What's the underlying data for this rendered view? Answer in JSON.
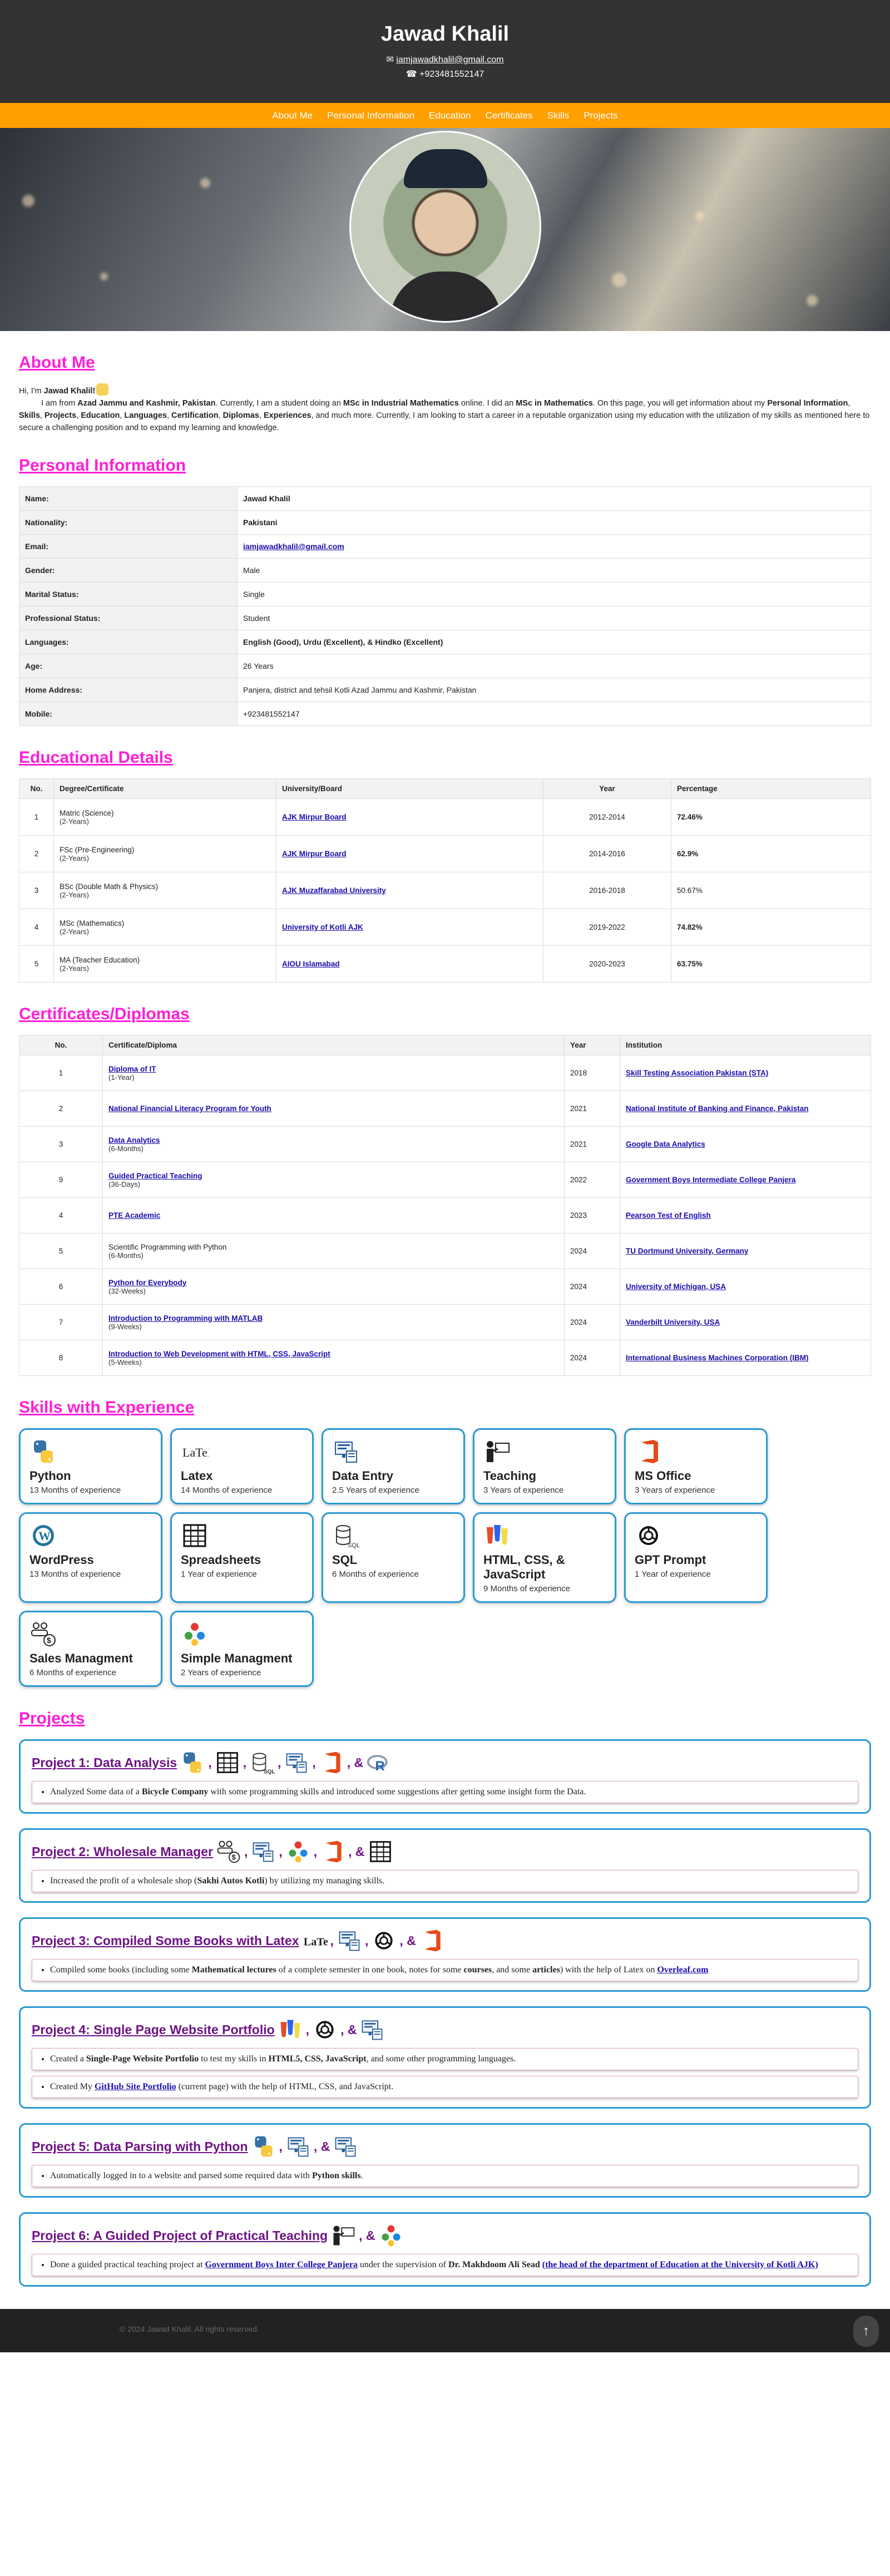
{
  "header": {
    "name": "Jawad Khalil",
    "email": "iamjawadkhalil@gmail.com",
    "phone": "+923481552147"
  },
  "nav": [
    "About Me",
    "Personal Information",
    "Education",
    "Certificates",
    "Skills",
    "Projects"
  ],
  "about": {
    "title": "About Me",
    "greet": "Hi, I'm",
    "name": "Jawad Khalil!",
    "p": [
      {
        "t": "I am from "
      },
      {
        "b": "Azad Jammu and Kashmir, Pakistan"
      },
      {
        "t": ". Currently, I am a student doing an "
      },
      {
        "b": "MSc in Industrial Mathematics"
      },
      {
        "t": " online. I did an "
      },
      {
        "b": "MSc in Mathematics"
      },
      {
        "t": ". On this page, you will get information about my "
      },
      {
        "b": "Personal Information"
      },
      {
        "t": ", "
      },
      {
        "b": "Skills"
      },
      {
        "t": ", "
      },
      {
        "b": "Projects"
      },
      {
        "t": ", "
      },
      {
        "b": "Education"
      },
      {
        "t": ", "
      },
      {
        "b": "Languages"
      },
      {
        "t": ", "
      },
      {
        "b": "Certification"
      },
      {
        "t": ", "
      },
      {
        "b": "Diplomas"
      },
      {
        "t": ", "
      },
      {
        "b": "Experiences"
      },
      {
        "t": ", and much more. Currently, I am looking to start a career in a reputable organization using my education with the utilization of my skills as mentioned here to secure a challenging position and to expand my learning and knowledge."
      }
    ]
  },
  "personal": {
    "title": "Personal Information",
    "rows": [
      {
        "k": "Name:",
        "v": "Jawad Khalil",
        "bold": true
      },
      {
        "k": "Nationality:",
        "v": "Pakistani",
        "bold": true
      },
      {
        "k": "Email:",
        "v": "iamjawadkhalil@gmail.com",
        "link": true
      },
      {
        "k": "Gender:",
        "v": "Male"
      },
      {
        "k": "Marital Status:",
        "v": "Single"
      },
      {
        "k": "Professional Status:",
        "v": "Student"
      },
      {
        "k": "Languages:",
        "v": "English (Good), Urdu (Excellent), & Hindko (Excellent)",
        "bold": true
      },
      {
        "k": "Age:",
        "v": "26 Years"
      },
      {
        "k": "Home Address:",
        "v": "Panjera, district and tehsil Kotli Azad Jammu and Kashmir, Pakistan"
      },
      {
        "k": "Mobile:",
        "v": "+923481552147"
      }
    ]
  },
  "education": {
    "title": "Educational Details",
    "cols": [
      "No.",
      "Degree/Certificate",
      "University/Board",
      "Year",
      "Percentage"
    ],
    "rows": [
      {
        "no": "1",
        "deg": "Matric (Science)",
        "dur": "(2-Years)",
        "uni": "AJK Mirpur Board",
        "year": "2012-2014",
        "pct": "72.46%",
        "pb": true
      },
      {
        "no": "2",
        "deg": "FSc (Pre-Engineering)",
        "dur": "(2-Years)",
        "uni": "AJK Mirpur Board",
        "year": "2014-2016",
        "pct": "62.9%",
        "pb": true
      },
      {
        "no": "3",
        "deg": "BSc (Double Math & Physics)",
        "dur": "(2-Years)",
        "uni": "AJK Muzaffarabad University",
        "year": "2016-2018",
        "pct": "50.67%",
        "pb": false
      },
      {
        "no": "4",
        "deg": "MSc (Mathematics)",
        "dur": "(2-Years)",
        "uni": "University of Kotli AJK",
        "year": "2019-2022",
        "pct": "74.82%",
        "pb": true
      },
      {
        "no": "5",
        "deg": "MA (Teacher Education)",
        "dur": "(2-Years)",
        "uni": "AIOU Islamabad",
        "year": "2020-2023",
        "pct": "63.75%",
        "pb": true
      }
    ]
  },
  "certs": {
    "title": "Certificates/Diplomas",
    "cols": [
      "No.",
      "Certificate/Diploma",
      "Year",
      "Institution"
    ],
    "rows": [
      {
        "no": "1",
        "name": "Diploma of IT",
        "dur": "(1-Year)",
        "link": true,
        "year": "2018",
        "inst": "Skill Testing Association Pakistan (STA)"
      },
      {
        "no": "2",
        "name": "National Financial Literacy Program for Youth",
        "dur": "",
        "link": true,
        "year": "2021",
        "inst": "National Institute of Banking and Finance, Pakistan"
      },
      {
        "no": "3",
        "name": "Data Analytics",
        "dur": "(6-Months)",
        "link": true,
        "year": "2021",
        "inst": "Google Data Analytics"
      },
      {
        "no": "9",
        "name": "Guided Practical Teaching",
        "dur": "(36-Days)",
        "link": true,
        "year": "2022",
        "inst": "Government Boys Intermediate College Panjera"
      },
      {
        "no": "4",
        "name": "PTE Academic",
        "dur": "",
        "link": true,
        "year": "2023",
        "inst": "Pearson Test of English"
      },
      {
        "no": "5",
        "name": "Scientific Programming with Python",
        "dur": "(6-Months)",
        "link": false,
        "year": "2024",
        "inst": "TU Dortmund University, Germany"
      },
      {
        "no": "6",
        "name": "Python for Everybody",
        "dur": "(32-Weeks)",
        "link": true,
        "year": "2024",
        "inst": "University of Michigan, USA"
      },
      {
        "no": "7",
        "name": "Introduction to Programming with MATLAB",
        "dur": "(9-Weeks)",
        "link": true,
        "year": "2024",
        "inst": "Vanderbilt University, USA"
      },
      {
        "no": "8",
        "name": "Introduction to Web Development with HTML, CSS, JavaScript",
        "dur": "(5-Weeks)",
        "link": true,
        "year": "2024",
        "inst": "International Business Machines Corporation (IBM)"
      }
    ]
  },
  "skills": {
    "title": "Skills with Experience",
    "items": [
      {
        "icon": "python-icon",
        "name": "Python",
        "exp": "13 Months of experience"
      },
      {
        "icon": "latex-icon",
        "name": "Latex",
        "exp": "14 Months of experience"
      },
      {
        "icon": "data-entry-icon",
        "name": "Data Entry",
        "exp": "2.5 Years of experience"
      },
      {
        "icon": "teaching-icon",
        "name": "Teaching",
        "exp": "3 Years of experience"
      },
      {
        "icon": "ms-office-icon",
        "name": "MS Office",
        "exp": "3 Years of experience"
      },
      {
        "icon": "wordpress-icon",
        "name": "WordPress",
        "exp": "13 Months of experience"
      },
      {
        "icon": "spreadsheet-icon",
        "name": "Spreadsheets",
        "exp": "1 Year of experience"
      },
      {
        "icon": "sql-icon",
        "name": "SQL",
        "exp": "6 Months of experience"
      },
      {
        "icon": "html-css-js-icon",
        "name": "HTML, CSS, & JavaScript",
        "exp": "9 Months of experience"
      },
      {
        "icon": "gpt-icon",
        "name": "GPT Prompt",
        "exp": "1 Year of experience"
      },
      {
        "icon": "sales-icon",
        "name": "Sales Managment",
        "exp": "6 Months of experience"
      },
      {
        "icon": "management-icon",
        "name": "Simple Managment",
        "exp": "2 Years of experience"
      }
    ]
  },
  "projects": {
    "title": "Projects",
    "items": [
      {
        "title": "Project 1: Data Analysis",
        "icons": [
          "python-icon",
          "spreadsheet-icon",
          "sql-icon",
          "data-entry-icon",
          "ms-office-icon",
          "r-icon"
        ],
        "bullets": [
          [
            {
              "t": "Analyzed Some data of a "
            },
            {
              "b": "Bicycle Company"
            },
            {
              "t": " with some programming skills and introduced some suggestions after getting some insight form the Data."
            }
          ]
        ]
      },
      {
        "title": "Project 2: Wholesale Manager",
        "icons": [
          "sales-icon",
          "data-entry-icon",
          "management-icon",
          "ms-office-icon",
          "spreadsheet-icon"
        ],
        "bullets": [
          [
            {
              "t": "Increased the profit of a wholesale shop ("
            },
            {
              "b": "Sakhi Autos Kotli"
            },
            {
              "t": ") by utilizing my managing skills."
            }
          ]
        ]
      },
      {
        "title": "Project 3: Compiled Some Books with Latex",
        "icons": [
          "latex-icon",
          "data-entry-icon",
          "gpt-icon",
          "ms-office-icon"
        ],
        "bullets": [
          [
            {
              "t": "Compiled some books (including some "
            },
            {
              "b": "Mathematical lectures"
            },
            {
              "t": " of a complete semester in one book, notes for some "
            },
            {
              "b": "courses"
            },
            {
              "t": ", and some "
            },
            {
              "b": "articles"
            },
            {
              "t": ") with the help of Latex on "
            },
            {
              "a": "Overleaf.com"
            }
          ]
        ]
      },
      {
        "title": "Project 4: Single Page Website Portfolio",
        "icons": [
          "html-css-js-icon",
          "gpt-icon",
          "data-entry-icon"
        ],
        "bullets": [
          [
            {
              "t": "Created a "
            },
            {
              "b": "Single-Page Website Portfolio"
            },
            {
              "t": " to test my skills in "
            },
            {
              "b": "HTML5, CSS, JavaScript"
            },
            {
              "t": ", and some other programming languages."
            }
          ],
          [
            {
              "t": "Created My "
            },
            {
              "a": "GitHub Site Portfolio"
            },
            {
              "t": " (current page) with the help of HTML, CSS, and JavaScript."
            }
          ]
        ]
      },
      {
        "title": "Project 5: Data Parsing with Python",
        "icons": [
          "python-icon",
          "data-entry-icon",
          "data-entry-icon"
        ],
        "bullets": [
          [
            {
              "t": "Automatically logged in to a website and parsed some required data with "
            },
            {
              "b": "Python skills"
            },
            {
              "t": "."
            }
          ]
        ]
      },
      {
        "title": "Project 6: A Guided Project of Practical Teaching",
        "icons": [
          "teaching-icon",
          "management-icon"
        ],
        "bullets": [
          [
            {
              "t": "Done a guided practical teaching project at "
            },
            {
              "a": "Government Boys Inter College Panjera"
            },
            {
              "t": " under the supervision of "
            },
            {
              "b": "Dr. Makhdoom Ali Sead"
            },
            {
              "t": " "
            },
            {
              "a": "(the head of the department of Education at the University of Kotli AJK)"
            }
          ]
        ]
      }
    ]
  },
  "footer": "© 2024 Jawad Khalil. All rights reserved.",
  "colors": {
    "header": "#333333",
    "nav": "#ff9f00",
    "heading": "#ff1fd6",
    "card_border": "#2a9ad3",
    "project_title": "#6f1386"
  }
}
